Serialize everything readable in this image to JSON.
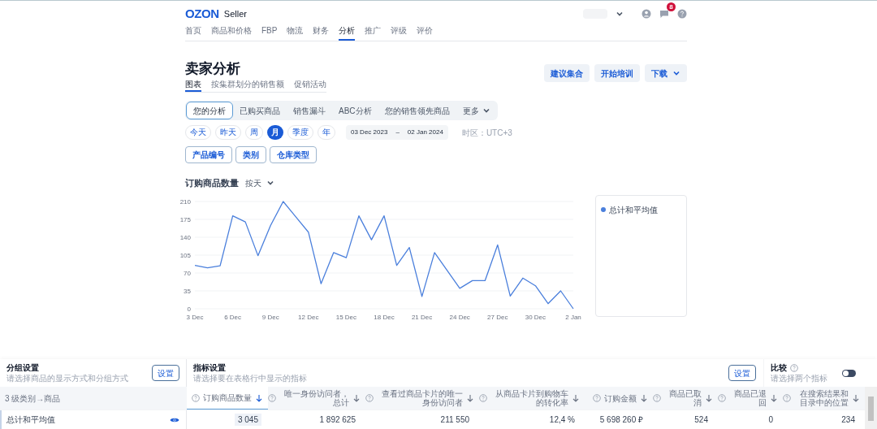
{
  "header": {
    "logo": "OZON",
    "product": "Seller",
    "notification_count": "8"
  },
  "nav": [
    {
      "label": "首页",
      "selected": false
    },
    {
      "label": "商品和价格",
      "selected": false
    },
    {
      "label": "FBP",
      "selected": false
    },
    {
      "label": "物流",
      "selected": false
    },
    {
      "label": "财务",
      "selected": false
    },
    {
      "label": "分析",
      "selected": true
    },
    {
      "label": "推广",
      "selected": false
    },
    {
      "label": "评级",
      "selected": false
    },
    {
      "label": "评价",
      "selected": false
    }
  ],
  "page_title": "卖家分析",
  "sub_tabs": [
    {
      "label": "图表",
      "selected": true
    },
    {
      "label": "按集群划分的销售额",
      "selected": false
    },
    {
      "label": "促销活动",
      "selected": false
    }
  ],
  "actions": [
    {
      "label": "建议集合",
      "dropdown": false
    },
    {
      "label": "开始培训",
      "dropdown": false
    },
    {
      "label": "下载",
      "dropdown": true
    }
  ],
  "report_tabs": [
    {
      "label": "您的分析",
      "selected": true,
      "dropdown": false
    },
    {
      "label": "已购买商品",
      "selected": false,
      "dropdown": false
    },
    {
      "label": "销售漏斗",
      "selected": false,
      "dropdown": false
    },
    {
      "label": "ABC分析",
      "selected": false,
      "dropdown": false
    },
    {
      "label": "您的销售领先商品",
      "selected": false,
      "dropdown": false
    },
    {
      "label": "更多",
      "selected": false,
      "dropdown": true
    }
  ],
  "periods": [
    {
      "label": "今天",
      "selected": false
    },
    {
      "label": "昨天",
      "selected": false
    },
    {
      "label": "周",
      "selected": false
    },
    {
      "label": "月",
      "selected": true
    },
    {
      "label": "季度",
      "selected": false
    },
    {
      "label": "年",
      "selected": false
    }
  ],
  "date_range": {
    "from": "03 Dec 2023",
    "separator": "–",
    "to": "02 Jan 2024"
  },
  "timezone": "时区：UTC+3",
  "filters": [
    "产品编号",
    "类别",
    "仓库类型"
  ],
  "chart": {
    "title": "订购商品数量",
    "granularity": "按天",
    "chart_data": {
      "type": "line",
      "grid": true,
      "categories": [
        "3 Dec",
        null,
        null,
        "6 Dec",
        null,
        null,
        "9 Dec",
        null,
        null,
        "12 Dec",
        null,
        null,
        "15 Dec",
        null,
        null,
        "18 Dec",
        null,
        null,
        "21 Dec",
        null,
        null,
        "24 Dec",
        null,
        null,
        "27 Dec",
        null,
        null,
        "30 Dec",
        null,
        null,
        "2 Jan"
      ],
      "ylim": [
        0,
        210
      ],
      "yticks": [
        0,
        35,
        70,
        105,
        140,
        175,
        210
      ],
      "series": [
        {
          "name": "总计和平均值",
          "color": "#4a7fdc",
          "values": [
            85,
            80,
            84,
            182,
            170,
            104,
            163,
            210,
            180,
            150,
            49,
            110,
            100,
            182,
            135,
            182,
            85,
            120,
            24,
            110,
            75,
            40,
            55,
            55,
            125,
            25,
            60,
            45,
            10,
            35,
            0
          ]
        }
      ]
    }
  },
  "grouping": {
    "title": "分组设置",
    "hint": "请选择商品的显示方式和分组方式",
    "button": "设置"
  },
  "metrics": {
    "title": "指标设置",
    "hint": "请选择要在表格行中显示的指标",
    "button": "设置"
  },
  "compare": {
    "title": "比较",
    "hint": "请选择两个指标",
    "on": false
  },
  "table": {
    "columns": [
      {
        "label": "3 级类别→商品",
        "sortable": false,
        "sorted": false
      },
      {
        "label": "订购商品数量",
        "sortable": true,
        "sorted": true
      },
      {
        "label": "唯一身份访问者，总计",
        "sortable": true,
        "sorted": false
      },
      {
        "label": "查看过商品卡片的唯一身份访问者",
        "sortable": true,
        "sorted": false
      },
      {
        "label": "从商品卡片到购物车的转化率",
        "sortable": true,
        "sorted": false
      },
      {
        "label": "订购金额",
        "sortable": true,
        "sorted": false
      },
      {
        "label": "商品已取消",
        "sortable": true,
        "sorted": false
      },
      {
        "label": "商品已退回",
        "sortable": true,
        "sorted": false
      },
      {
        "label": "在搜索结果和目录中的位置",
        "sortable": true,
        "sorted": false
      }
    ],
    "rows": [
      {
        "cells": [
          "总计和平均值",
          "3 045",
          "1 892 625",
          "211 550",
          "12,4 %",
          "5 698 260 ₽",
          "524",
          "0",
          "234"
        ]
      }
    ]
  }
}
